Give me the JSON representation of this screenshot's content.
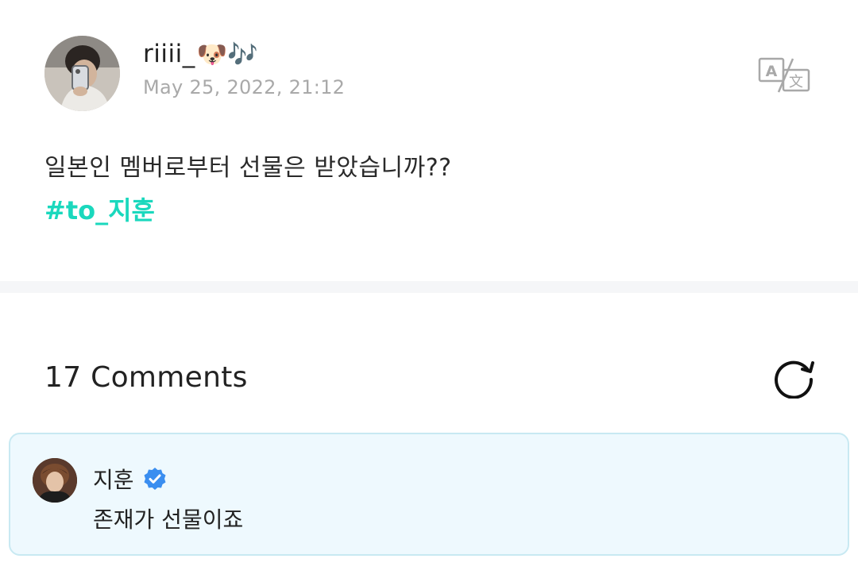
{
  "post": {
    "author_name": "riiii_",
    "author_emoji": "🐶🎶",
    "date": "May 25, 2022, 21:12",
    "body": "일본인 멤버로부터 선물은 받았습니까??",
    "hashtag": "#to_지훈",
    "avatar_icon": "profile-photo",
    "translate_icon": "translate-icon"
  },
  "comments": {
    "header": "17 Comments",
    "refresh_icon": "refresh-icon",
    "items": [
      {
        "author": "지훈",
        "verified": true,
        "text": "존재가 선물이죠"
      }
    ]
  },
  "colors": {
    "hashtag": "#1ad8bd",
    "comment_bg": "#eef9fe",
    "comment_border": "#c8e9f2",
    "verified": "#3a8ef0",
    "date": "#a9a9a9"
  }
}
